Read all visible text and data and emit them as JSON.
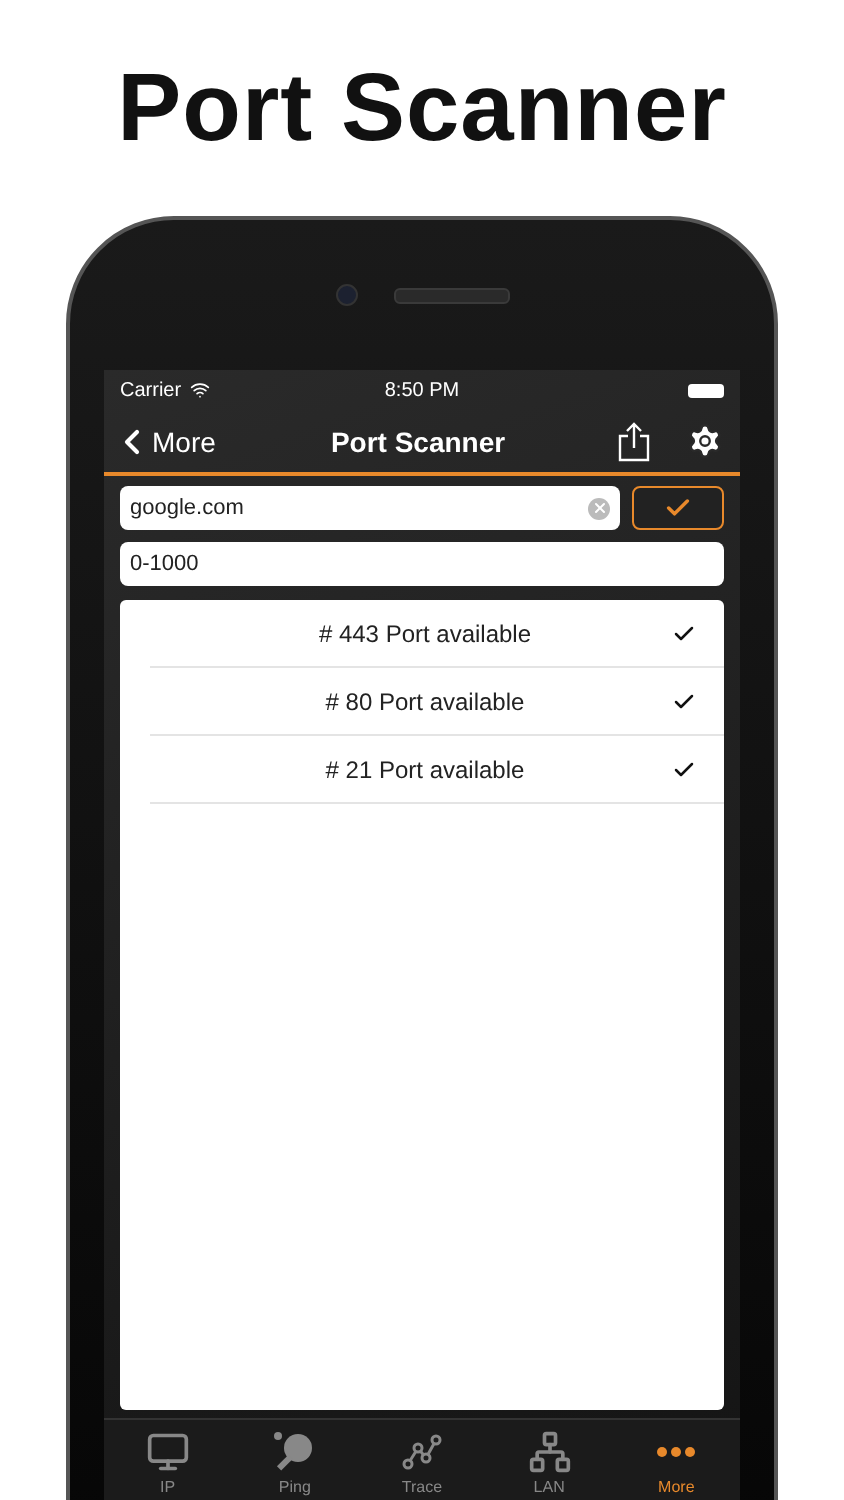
{
  "headline": "Port Scanner",
  "status_bar": {
    "carrier": "Carrier",
    "time": "8:50 PM"
  },
  "nav": {
    "back": "More",
    "title": "Port Scanner"
  },
  "host_field": {
    "value": "google.com"
  },
  "range_field": {
    "value": "0-1000"
  },
  "results": [
    {
      "label": "# 443 Port available",
      "checked": true
    },
    {
      "label": "# 80 Port available",
      "checked": true
    },
    {
      "label": "# 21 Port available",
      "checked": true
    }
  ],
  "tab_bar": [
    {
      "label": "IP",
      "kind": "ip",
      "selected": false
    },
    {
      "label": "Ping",
      "kind": "ping",
      "selected": false
    },
    {
      "label": "Trace",
      "kind": "trace",
      "selected": false
    },
    {
      "label": "LAN",
      "kind": "lan",
      "selected": false
    },
    {
      "label": "More",
      "kind": "more",
      "selected": true
    }
  ]
}
